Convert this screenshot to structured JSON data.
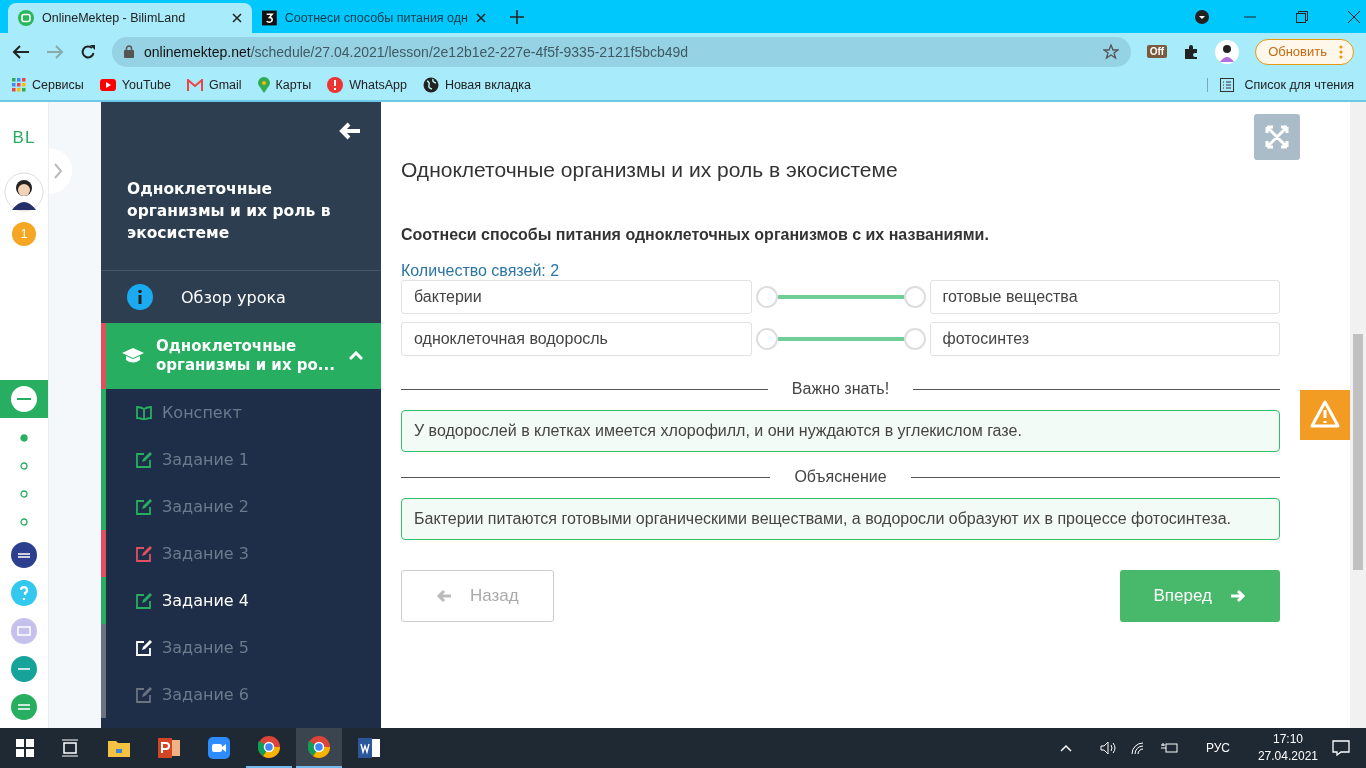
{
  "browser": {
    "tabs": [
      {
        "title": "OnlineMektep - BilimLand",
        "selected": true
      },
      {
        "title": "Соотнеси способы питания одн",
        "selected": false
      }
    ],
    "url_host": "onlinemektep.net",
    "url_path": "/schedule/27.04.2021/lesson/2e12b1e2-227e-4f5f-9335-2121f5bcb49d",
    "extension_badge": "Off",
    "update_button": "Обновить",
    "bookmarks": [
      {
        "label": "Сервисы",
        "kind": "apps"
      },
      {
        "label": "YouTube",
        "kind": "youtube"
      },
      {
        "label": "Gmail",
        "kind": "gmail"
      },
      {
        "label": "Карты",
        "kind": "maps"
      },
      {
        "label": "WhatsApp",
        "kind": "alert"
      },
      {
        "label": "Новая вкладка",
        "kind": "globe"
      }
    ],
    "reading_list": "Список для чтения"
  },
  "rail": {
    "logo": "BL",
    "badge": "1",
    "steps": [
      {
        "selected": true
      },
      {
        "selected": false
      },
      {
        "selected": false
      },
      {
        "selected": false
      }
    ]
  },
  "sidebar": {
    "title": "Одноклеточные организмы и их роль в экосистеме",
    "overview": "Обзор урока",
    "section": {
      "title": "Одноклеточные организмы и их ро...",
      "expanded": true
    },
    "items": [
      {
        "label": "Конспект",
        "kind": "book",
        "color": "#27ae60",
        "selected": false
      },
      {
        "label": "Задание 1",
        "kind": "task",
        "color": "#27ae60",
        "selected": false
      },
      {
        "label": "Задание 2",
        "kind": "task",
        "color": "#27ae60",
        "selected": false
      },
      {
        "label": "Задание 3",
        "kind": "task",
        "color": "#e0505f",
        "selected": false
      },
      {
        "label": "Задание 4",
        "kind": "task",
        "color": "#27ae60",
        "selected": true
      },
      {
        "label": "Задание 5",
        "kind": "task",
        "color": "#6b7280",
        "selected": false
      },
      {
        "label": "Задание 6",
        "kind": "task",
        "color": "#6b7280",
        "selected": false
      }
    ]
  },
  "content": {
    "title": "Одноклеточные организмы и их роль в экосистеме",
    "question": "Соотнеси способы питания одноклеточных организмов с их названиями.",
    "links_count": "Количество связей: 2",
    "pairs": [
      {
        "left": "бактерии",
        "right": "готовые вещества"
      },
      {
        "left": "одноклеточная водоросль",
        "right": "фотосинтез"
      }
    ],
    "important_heading": "Важно знать!",
    "important_text": "У водорослей в клетках имеется хлорофилл, и они нуждаются в углекислом газе.",
    "explanation_heading": "Объяснение",
    "explanation_text": "Бактерии питаются готовыми органическими веществами, а водоросли образуют их в процессе фотосинтеза.",
    "back_button": "Назад",
    "forward_button": "Вперед"
  },
  "taskbar": {
    "language": "РУС",
    "time": "17:10",
    "date": "27.04.2021"
  }
}
